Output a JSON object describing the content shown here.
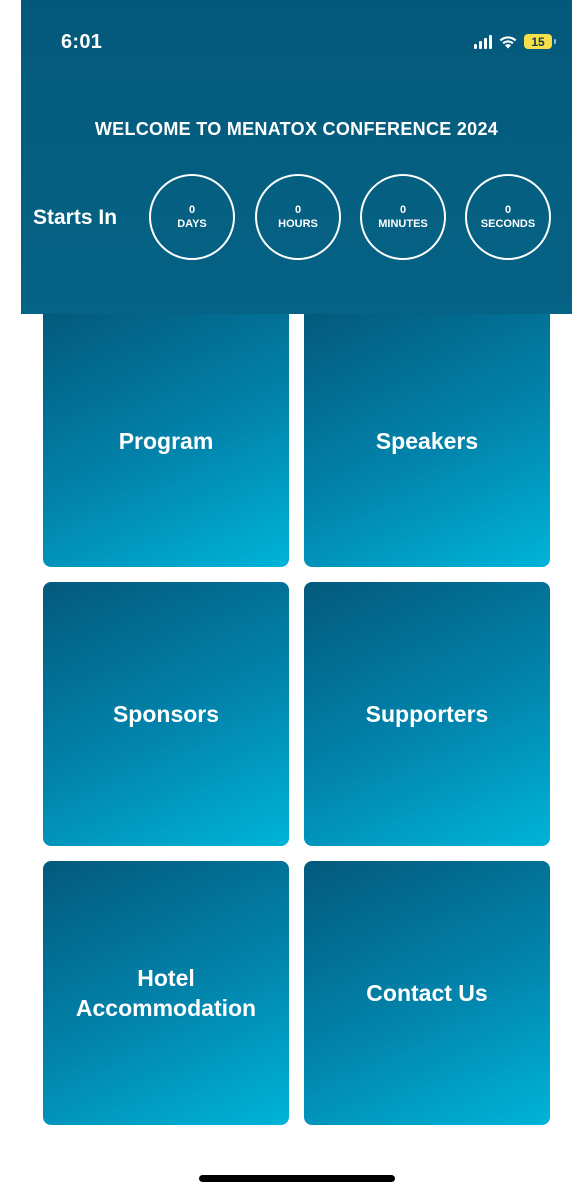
{
  "status_bar": {
    "time": "6:01",
    "battery": "15"
  },
  "header": {
    "title": "WELCOME TO MENATOX CONFERENCE 2024",
    "starts_label": "Starts In"
  },
  "countdown": [
    {
      "value": "0",
      "label": "DAYS"
    },
    {
      "value": "0",
      "label": "HOURS"
    },
    {
      "value": "0",
      "label": "MINUTES"
    },
    {
      "value": "0",
      "label": "SECONDS"
    }
  ],
  "tiles": [
    {
      "label": "Program"
    },
    {
      "label": "Speakers"
    },
    {
      "label": "Sponsors"
    },
    {
      "label": "Supporters"
    },
    {
      "label": "Hotel Accommodation"
    },
    {
      "label": "Contact Us"
    }
  ],
  "colors": {
    "header": "#04597a",
    "tile_dark": "#03597c",
    "tile_light": "#00b4d8"
  },
  "icons": [
    "signal-icon",
    "wifi-icon",
    "battery-icon"
  ]
}
